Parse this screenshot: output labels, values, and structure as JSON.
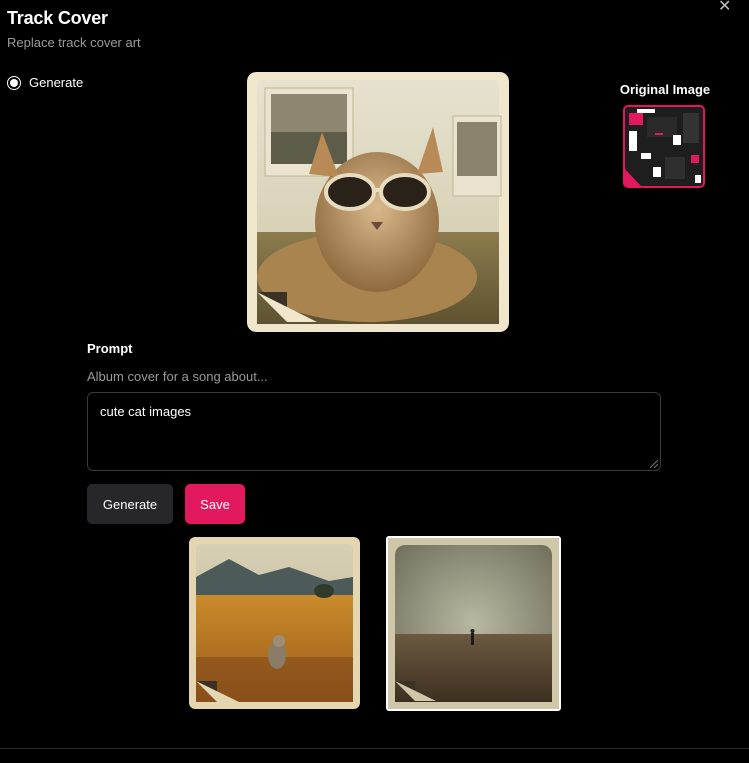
{
  "dialog": {
    "title": "Track Cover",
    "subtitle": "Replace track cover art",
    "close_icon": "close-icon"
  },
  "mode": {
    "option_label": "Generate",
    "selected": true
  },
  "original": {
    "label": "Original Image"
  },
  "prompt": {
    "label": "Prompt",
    "placeholder": "Album cover for a song about...",
    "value": "cute cat images"
  },
  "actions": {
    "generate_label": "Generate",
    "save_label": "Save"
  },
  "colors": {
    "accent": "#e2195f",
    "background": "#000000",
    "secondary_button": "#27272a"
  }
}
